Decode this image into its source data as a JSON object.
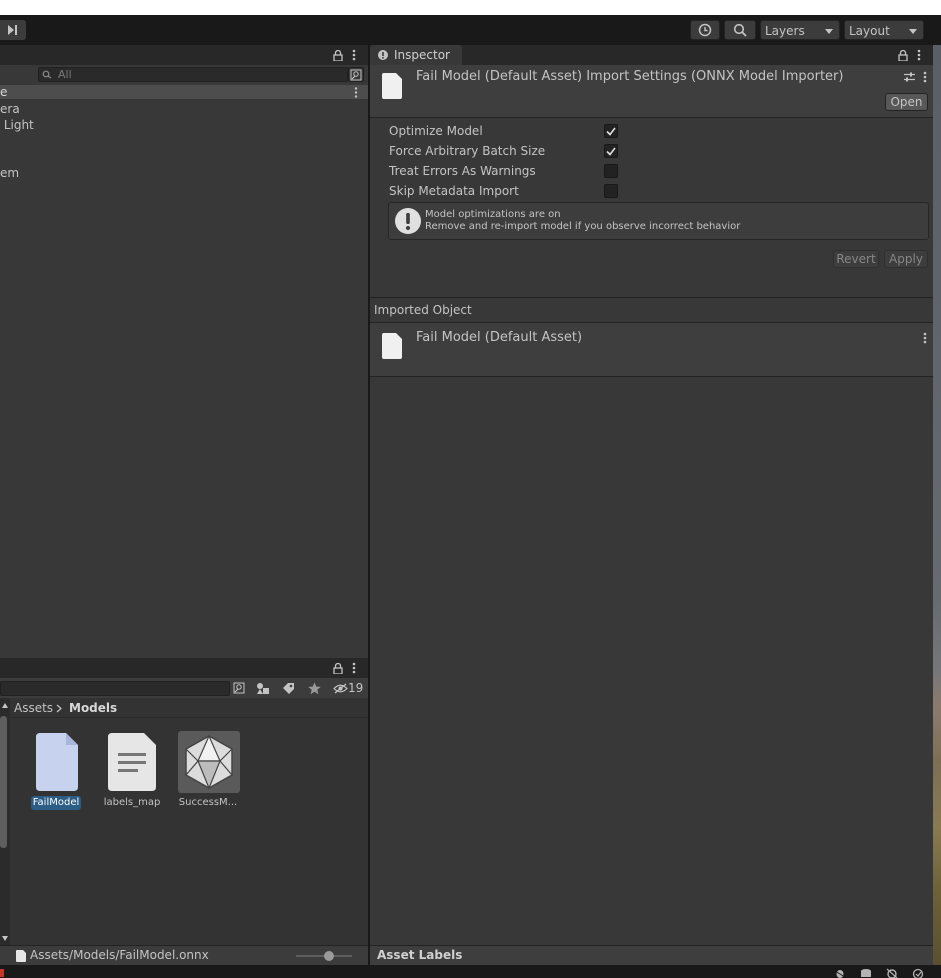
{
  "toolbar": {
    "layers_label": "Layers",
    "layout_label": "Layout"
  },
  "hierarchy": {
    "search_placeholder": "All",
    "header_label": "e",
    "items": [
      "era",
      " Light",
      "em"
    ]
  },
  "inspector": {
    "tab_label": "Inspector",
    "title": "Fail Model (Default Asset) Import Settings (ONNX Model Importer)",
    "open_button": "Open",
    "settings": [
      {
        "label": "Optimize Model",
        "checked": true
      },
      {
        "label": "Force Arbitrary Batch Size",
        "checked": true
      },
      {
        "label": "Treat Errors As Warnings",
        "checked": false
      },
      {
        "label": "Skip Metadata Import",
        "checked": false
      }
    ],
    "info_line1": "Model optimizations are on",
    "info_line2": "Remove and re-import model if you observe incorrect behavior",
    "revert_button": "Revert",
    "apply_button": "Apply",
    "imported_object_header": "Imported Object",
    "imported_object_name": "Fail Model (Default Asset)",
    "asset_labels_header": "Asset Labels"
  },
  "project": {
    "hidden_count": "19",
    "breadcrumb_root": "Assets",
    "breadcrumb_current": "Models",
    "assets": [
      {
        "name": "FailModel",
        "selected": true
      },
      {
        "name": "labels_map",
        "selected": false
      },
      {
        "name": "SuccessM...",
        "selected": false
      }
    ],
    "path": "Assets/Models/FailModel.onnx"
  },
  "colors": {
    "accent": "#2c5d87",
    "panel": "#383838",
    "toolbar": "#191919"
  }
}
